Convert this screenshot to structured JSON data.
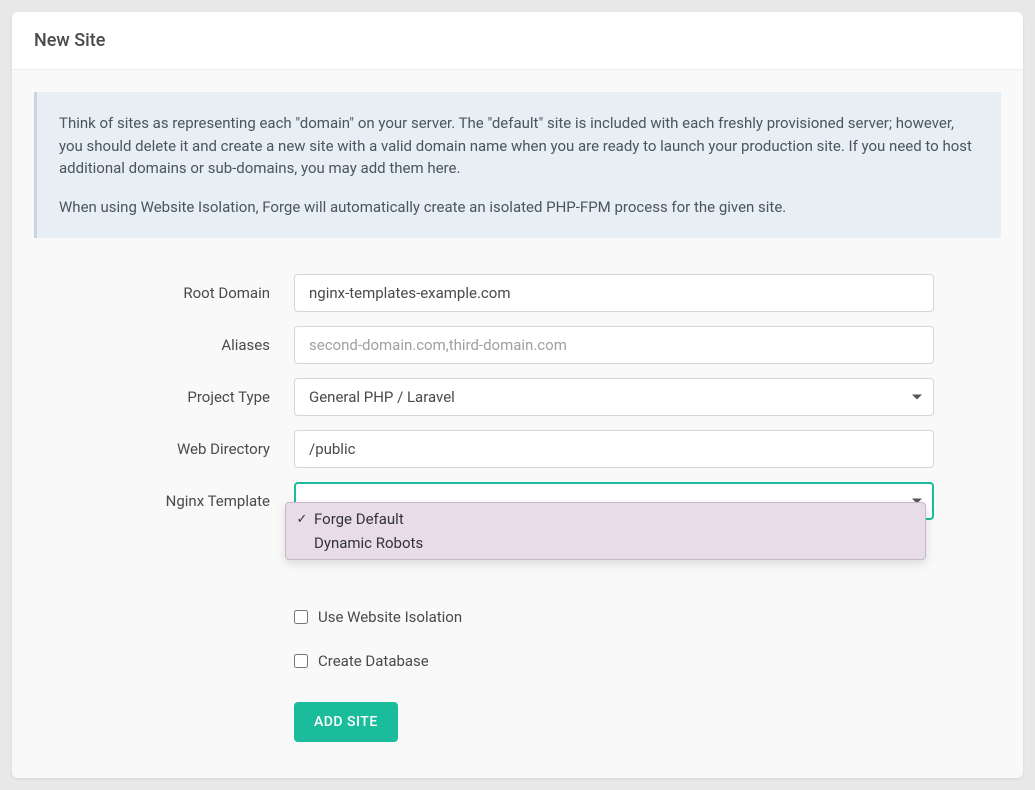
{
  "header": {
    "title": "New Site"
  },
  "info": {
    "p1": "Think of sites as representing each \"domain\" on your server. The \"default\" site is included with each freshly provisioned server; however, you should delete it and create a new site with a valid domain name when you are ready to launch your production site. If you need to host additional domains or sub-domains, you may add them here.",
    "p2": "When using Website Isolation, Forge will automatically create an isolated PHP-FPM process for the given site."
  },
  "form": {
    "root_domain": {
      "label": "Root Domain",
      "value": "nginx-templates-example.com"
    },
    "aliases": {
      "label": "Aliases",
      "value": "",
      "placeholder": "second-domain.com,third-domain.com"
    },
    "project_type": {
      "label": "Project Type",
      "selected": "General PHP / Laravel"
    },
    "web_directory": {
      "label": "Web Directory",
      "value": "/public"
    },
    "nginx_template": {
      "label": "Nginx Template",
      "selected": "Forge Default",
      "options": [
        {
          "label": "Forge Default",
          "checked": true
        },
        {
          "label": "Dynamic Robots",
          "checked": false
        }
      ]
    },
    "use_isolation": {
      "label": "Use Website Isolation",
      "checked": false
    },
    "create_db": {
      "label": "Create Database",
      "checked": false
    },
    "submit": {
      "label": "ADD SITE"
    }
  }
}
